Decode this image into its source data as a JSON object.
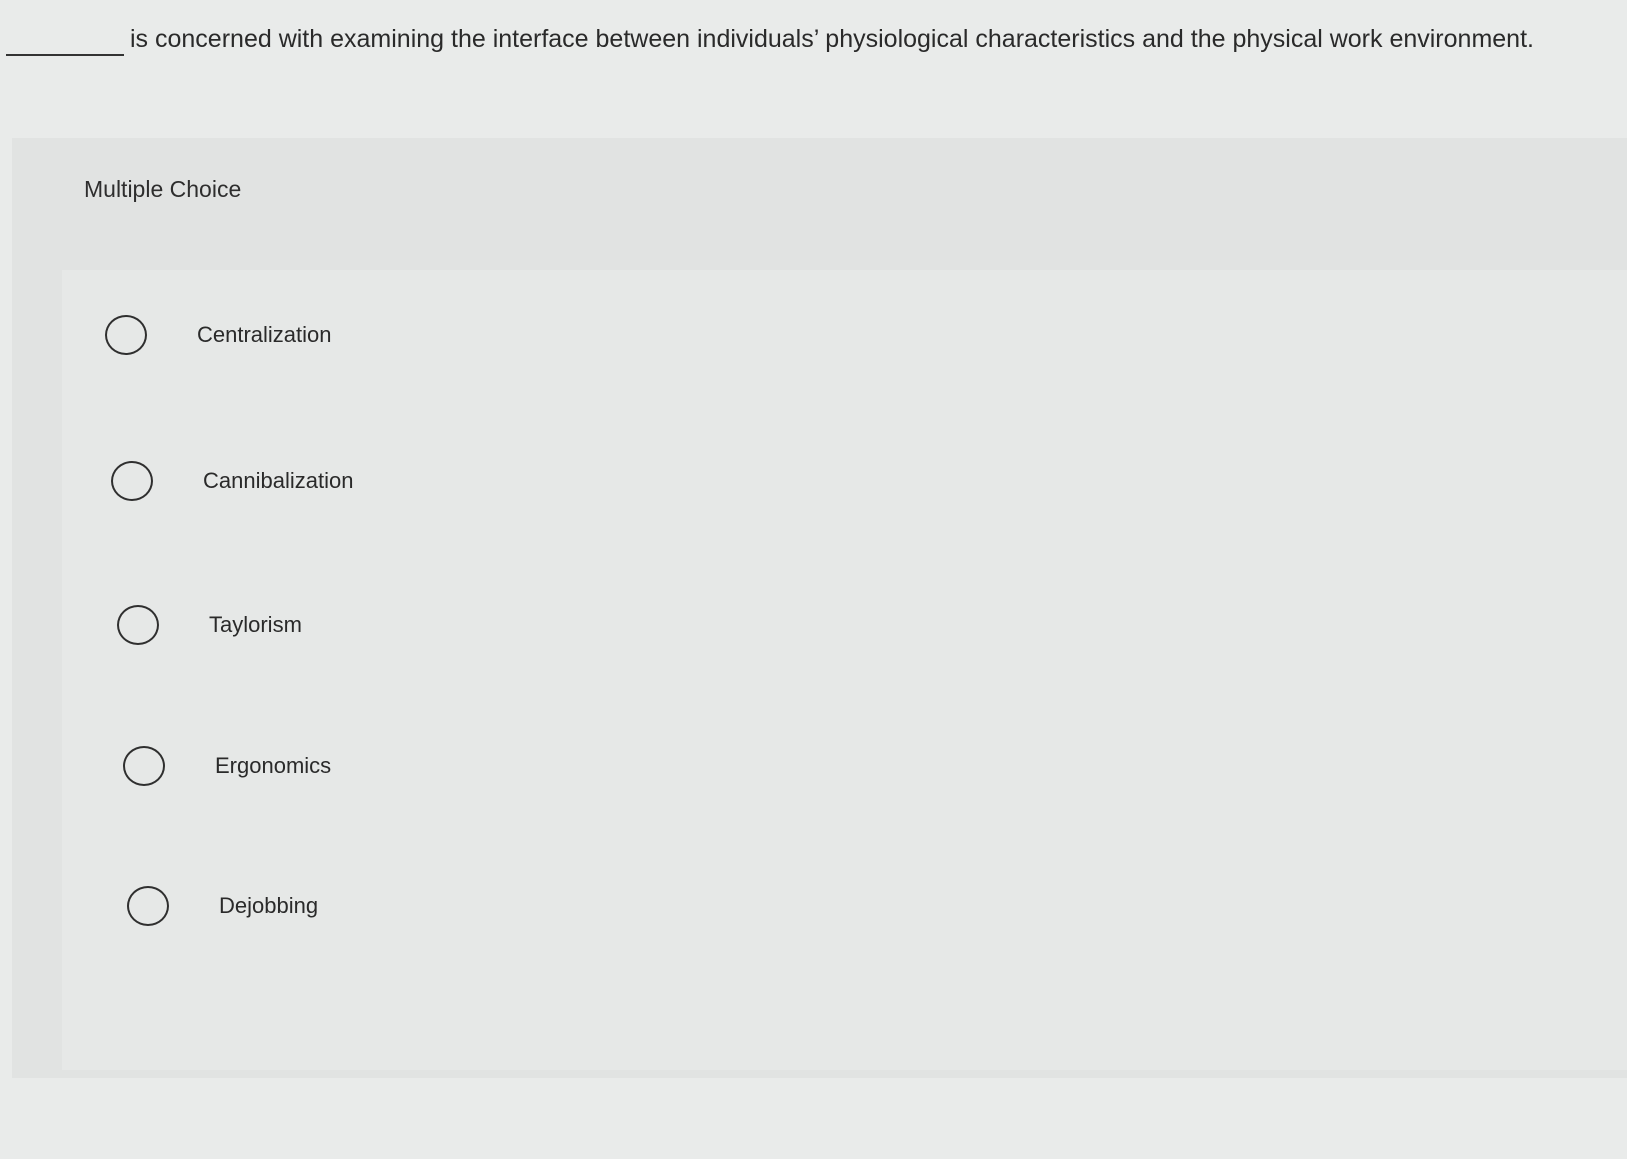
{
  "question": {
    "text": "is concerned with examining the interface between individuals’ physiological characteristics and the physical work environment."
  },
  "section_label": "Multiple Choice",
  "options": [
    {
      "label": "Centralization"
    },
    {
      "label": "Cannibalization"
    },
    {
      "label": "Taylorism"
    },
    {
      "label": "Ergonomics"
    },
    {
      "label": "Dejobbing"
    }
  ]
}
